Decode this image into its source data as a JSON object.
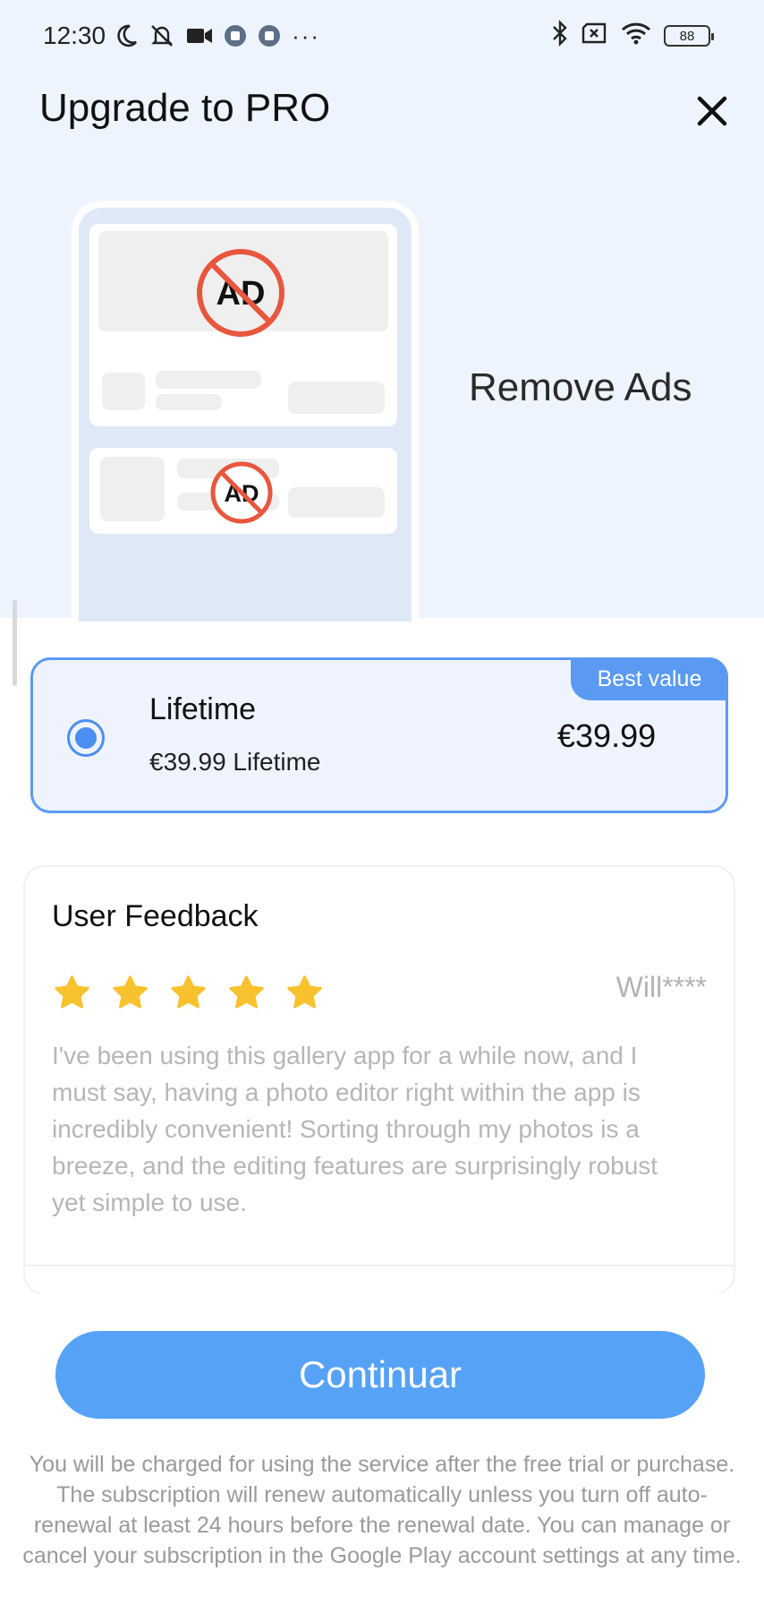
{
  "status_bar": {
    "time": "12:30",
    "more": "···",
    "battery": "88"
  },
  "header": {
    "title": "Upgrade to PRO",
    "close_icon": "close-icon"
  },
  "hero": {
    "feature": "Remove Ads",
    "ad_label": "AD"
  },
  "plan": {
    "badge": "Best value",
    "name": "Lifetime",
    "subtitle": "€39.99 Lifetime",
    "price": "€39.99",
    "selected": true
  },
  "feedback": {
    "title": "User Feedback",
    "rating": 5,
    "user": "Will****",
    "text": "I've been using this gallery app for a while now, and I must say, having a photo editor right within the app is incredibly convenient! Sorting through my photos is a breeze, and the editing features are surprisingly robust yet simple to use."
  },
  "cta": {
    "label": "Continuar"
  },
  "legal": {
    "text": "You will be charged for using the service after the free trial or purchase. The subscription will renew automatically unless you turn off auto-renewal at least 24 hours before the renewal date. You can manage or cancel your subscription in the Google Play account settings at any time."
  },
  "colors": {
    "accent": "#5b9af2",
    "button": "#56a2f6",
    "hero_bg": "#eef4fd",
    "star": "#f8c22e",
    "no_ad_red": "#e8563e"
  }
}
